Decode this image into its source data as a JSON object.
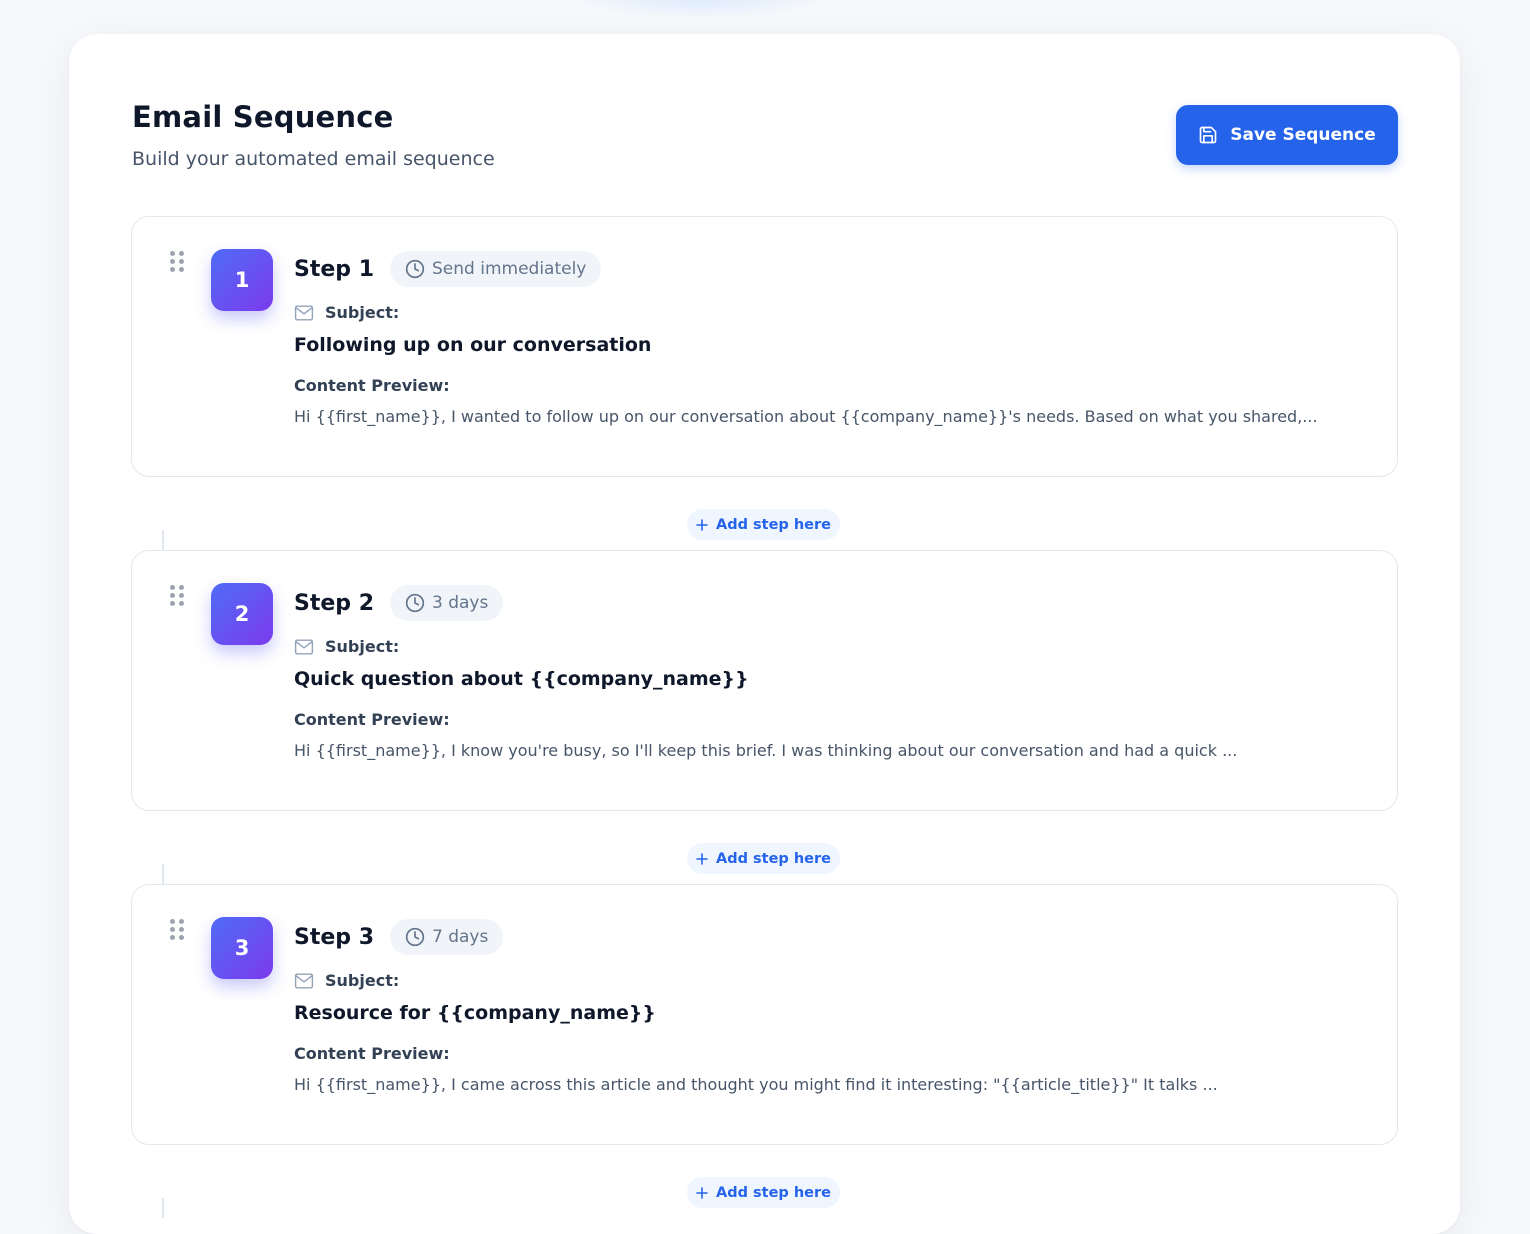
{
  "header": {
    "title": "Email Sequence",
    "subtitle": "Build your automated email sequence",
    "save_label": "Save Sequence"
  },
  "labels": {
    "subject": "Subject:",
    "content_preview": "Content Preview:",
    "add_step": "Add step here"
  },
  "steps": [
    {
      "number": "1",
      "title": "Step 1",
      "delay": "Send immediately",
      "subject": "Following up on our conversation",
      "preview": "Hi {{first_name}}, I wanted to follow up on our conversation about {{company_name}}'s needs. Based on what you shared,..."
    },
    {
      "number": "2",
      "title": "Step 2",
      "delay": "3 days",
      "subject": "Quick question about {{company_name}}",
      "preview": "Hi {{first_name}}, I know you're busy, so I'll keep this brief. I was thinking about our conversation and had a quick ..."
    },
    {
      "number": "3",
      "title": "Step 3",
      "delay": "7 days",
      "subject": "Resource for {{company_name}}",
      "preview": "Hi {{first_name}}, I came across this article and thought you might find it interesting: \"{{article_title}}\" It talks ..."
    }
  ],
  "colors": {
    "accent": "#2563eb",
    "badge_gradient_start": "#4f6cf7",
    "badge_gradient_end": "#7c3aed"
  },
  "icons": {
    "save": "floppy-disk-icon",
    "clock": "clock-icon",
    "mail": "envelope-icon",
    "drag": "drag-handle-icon",
    "add": "plus-icon"
  }
}
